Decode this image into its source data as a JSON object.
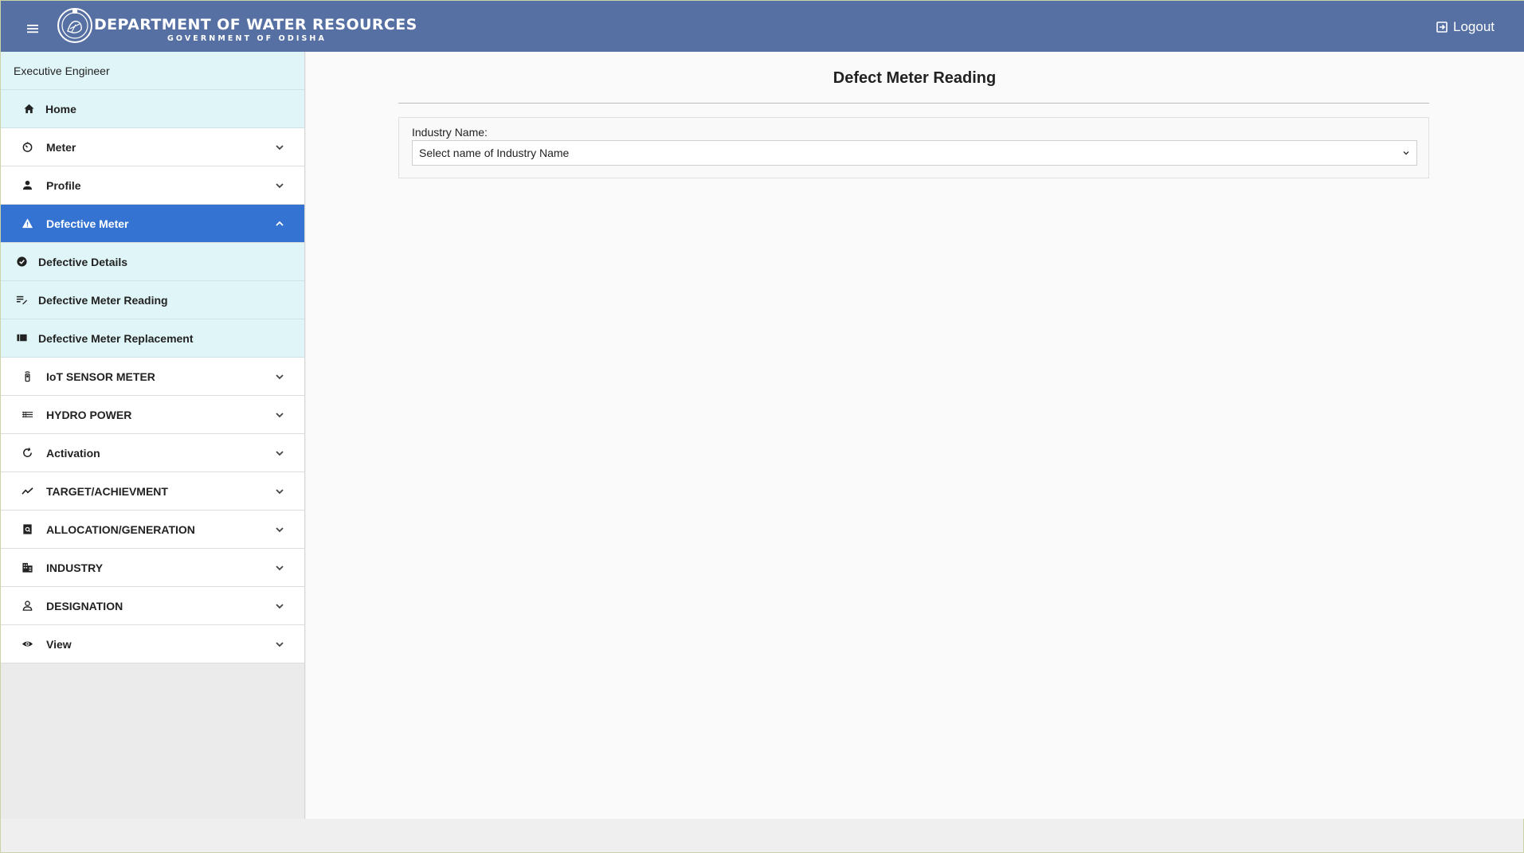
{
  "header": {
    "title": "DEPARTMENT OF WATER RESOURCES",
    "subtitle": "GOVERNMENT OF ODISHA",
    "logout_label": "Logout",
    "bg_color": "#5670a3"
  },
  "sidebar": {
    "user_role": "Executive Engineer",
    "active_color": "#3573d2",
    "items": [
      {
        "label": "Home",
        "icon": "home-icon"
      },
      {
        "label": "Meter",
        "icon": "gauge-icon"
      },
      {
        "label": "Profile",
        "icon": "person-icon"
      },
      {
        "label": "Defective Meter",
        "icon": "warning-icon",
        "expanded": true
      },
      {
        "label": "Defective Details",
        "icon": "check-circle-icon"
      },
      {
        "label": "Defective Meter Reading",
        "icon": "edit-note-icon"
      },
      {
        "label": "Defective Meter Replacement",
        "icon": "list-alt-icon"
      },
      {
        "label": "IoT SENSOR METER",
        "icon": "sensor-icon"
      },
      {
        "label": "HYDRO POWER",
        "icon": "waves-icon"
      },
      {
        "label": "Activation",
        "icon": "refresh-icon"
      },
      {
        "label": "TARGET/ACHIEVMENT",
        "icon": "trend-icon"
      },
      {
        "label": "ALLOCATION/GENERATION",
        "icon": "search-doc-icon"
      },
      {
        "label": "INDUSTRY",
        "icon": "building-icon"
      },
      {
        "label": "DESIGNATION",
        "icon": "person-outline-icon"
      },
      {
        "label": "View",
        "icon": "eye-icon"
      }
    ]
  },
  "main": {
    "title": "Defect Meter Reading",
    "form": {
      "industry_label": "Industry Name:",
      "industry_select_value": "Select name of Industry Name"
    }
  }
}
